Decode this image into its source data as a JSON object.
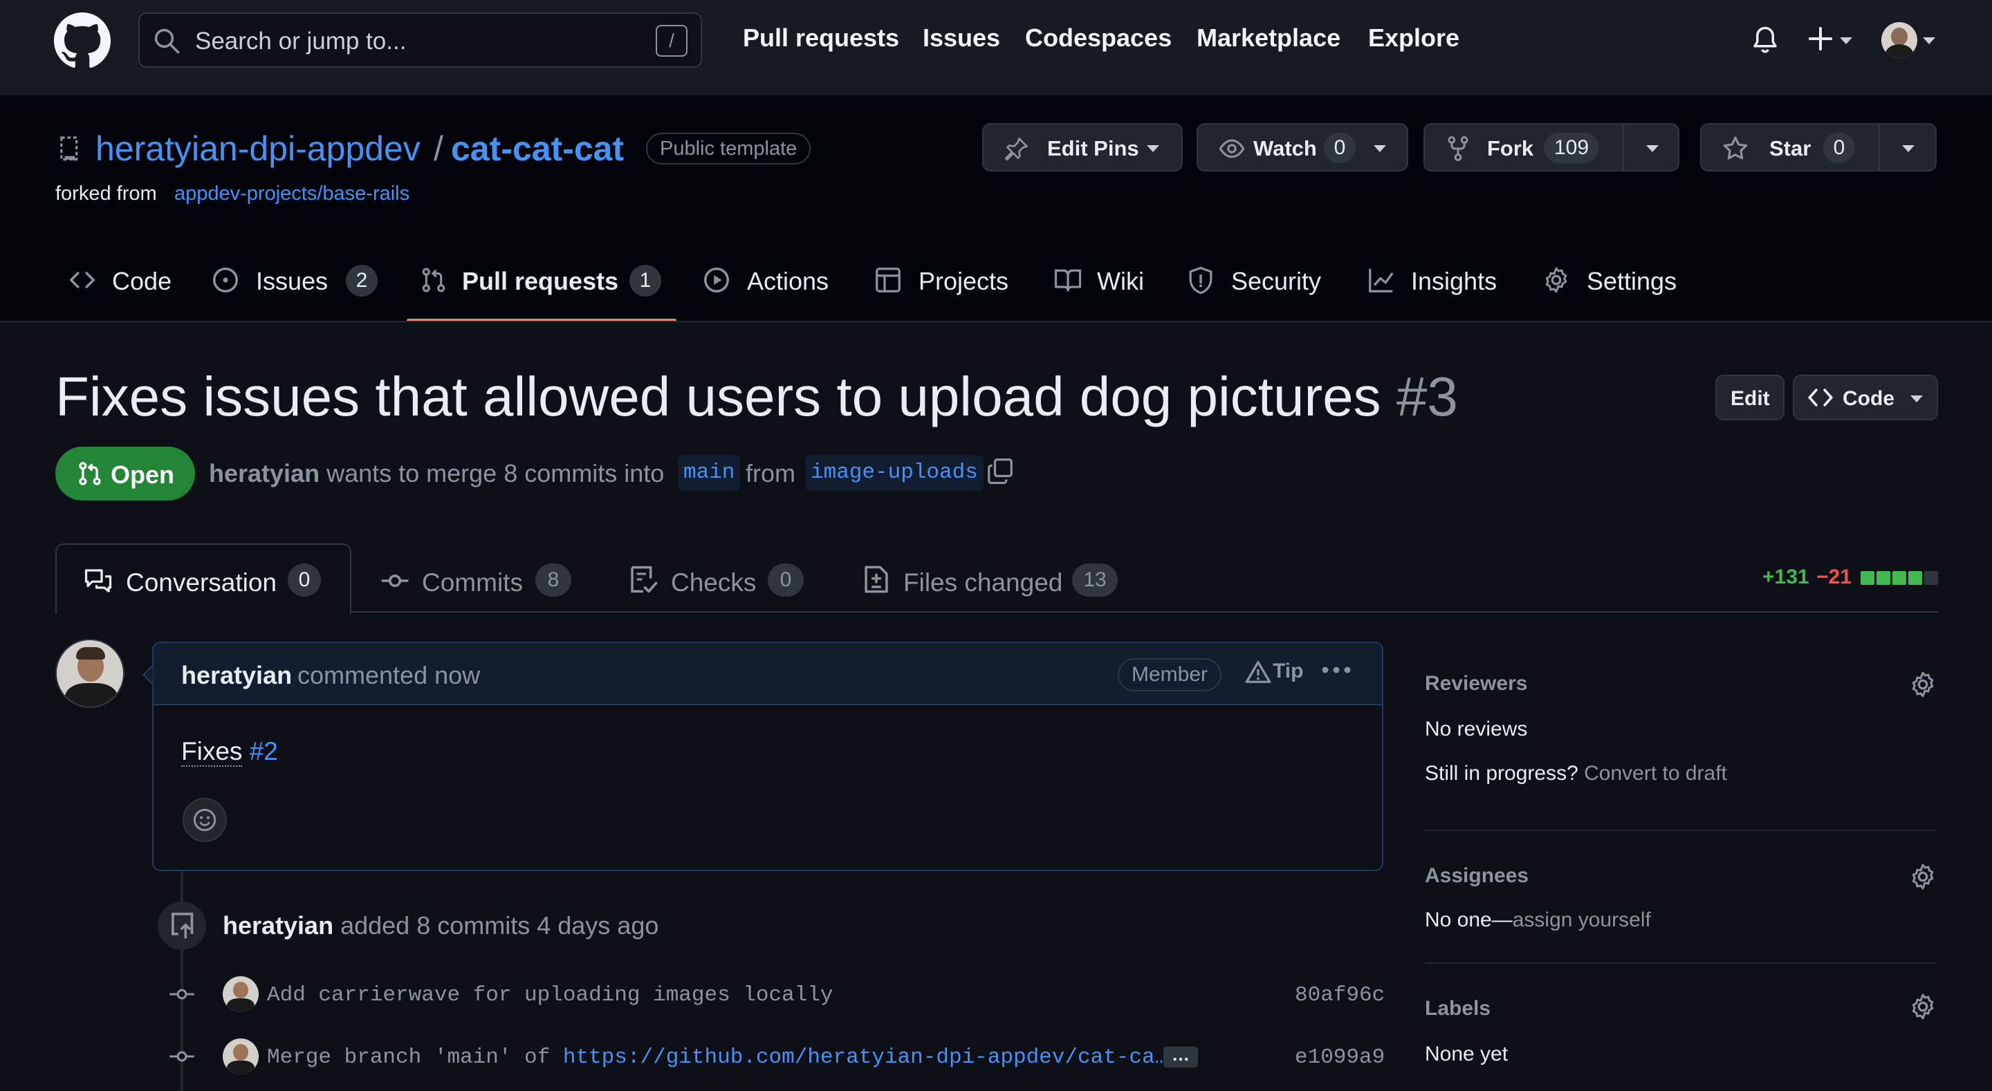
{
  "colors": {
    "accent": "#4493f8",
    "open_green": "#238636",
    "selected_tab_border": "#f78166",
    "additions": "#3fb950",
    "deletions": "#f85149",
    "bg": "#0d1117",
    "header_bg": "#161b22"
  },
  "topnav": {
    "search_placeholder": "Search or jump to...",
    "search_shortcut": "/",
    "links": [
      "Pull requests",
      "Issues",
      "Codespaces",
      "Marketplace",
      "Explore"
    ]
  },
  "repo": {
    "owner": "heratyian-dpi-appdev",
    "separator": "/",
    "name": "cat-cat-cat",
    "visibility": "Public template",
    "forked_prefix": "forked from",
    "forked_from": "appdev-projects/base-rails",
    "edit_pins": "Edit Pins",
    "watch": "Watch",
    "watch_count": "0",
    "fork": "Fork",
    "fork_count": "109",
    "star": "Star",
    "star_count": "0"
  },
  "repo_tabs": [
    {
      "label": "Code",
      "icon": "code-icon"
    },
    {
      "label": "Issues",
      "icon": "issue-icon",
      "count": "2"
    },
    {
      "label": "Pull requests",
      "icon": "pull-request-icon",
      "count": "1",
      "selected": true
    },
    {
      "label": "Actions",
      "icon": "play-icon"
    },
    {
      "label": "Projects",
      "icon": "table-icon"
    },
    {
      "label": "Wiki",
      "icon": "book-icon"
    },
    {
      "label": "Security",
      "icon": "shield-icon"
    },
    {
      "label": "Insights",
      "icon": "graph-icon"
    },
    {
      "label": "Settings",
      "icon": "gear-icon"
    }
  ],
  "pr": {
    "title": "Fixes issues that allowed users to upload dog pictures",
    "number": "#3",
    "edit": "Edit",
    "code": "Code",
    "state": "Open",
    "author": "heratyian",
    "merge_text": "wants to merge 8 commits into",
    "base_branch": "main",
    "from_text": "from",
    "head_branch": "image-uploads"
  },
  "pr_tabs": [
    {
      "label": "Conversation",
      "count": "0",
      "icon": "comment-discussion-icon"
    },
    {
      "label": "Commits",
      "count": "8",
      "icon": "commit-icon"
    },
    {
      "label": "Checks",
      "count": "0",
      "icon": "checklist-icon"
    },
    {
      "label": "Files changed",
      "count": "13",
      "icon": "file-diff-icon"
    }
  ],
  "diffstat": {
    "additions": "+131",
    "deletions": "−21",
    "blocks": [
      "green",
      "green",
      "green",
      "green",
      "gray"
    ]
  },
  "comment": {
    "author": "heratyian",
    "meta": "commented now",
    "badge": "Member",
    "tip": "Tip",
    "body_prefix": "Fixes",
    "body_link": "#2"
  },
  "timeline": {
    "event_author": "heratyian",
    "event_text": "added 8 commits 4 days ago",
    "commits": [
      {
        "message": "Add carrierwave for uploading images locally",
        "link": "",
        "sha": "80af96c"
      },
      {
        "message": "Merge branch 'main' of ",
        "link": "https://github.com/heratyian-dpi-appdev/cat-ca…",
        "sha": "e1099a9",
        "more": "…"
      }
    ]
  },
  "sidebar": {
    "reviewers_title": "Reviewers",
    "reviewers_value": "No reviews",
    "in_progress": "Still in progress?",
    "convert_draft": "Convert to draft",
    "assignees_title": "Assignees",
    "assignees_value": "No one—",
    "assign_yourself": "assign yourself",
    "labels_title": "Labels",
    "labels_value": "None yet"
  }
}
